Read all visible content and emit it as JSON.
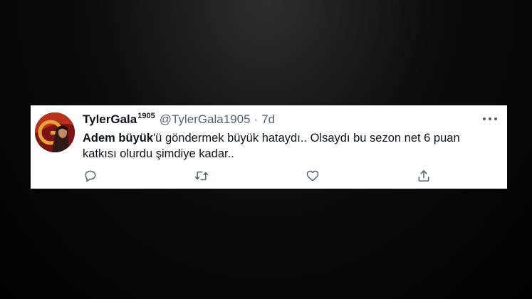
{
  "tweet": {
    "display_name": "TylerGala",
    "display_name_sup": "1905",
    "handle": "@TylerGala1905",
    "separator": "·",
    "time": "7d",
    "text": {
      "mention": "Adem büyük",
      "rest": "'ü göndermek büyük hataydı.. Olsaydı bu sezon net 6 puan katkısı olurdu şimdiye kadar.."
    }
  },
  "icons": {
    "more": "more-horizontal-icon",
    "reply": "reply-icon",
    "retweet": "retweet-icon",
    "like": "heart-icon",
    "share": "share-icon"
  },
  "colors": {
    "text_primary": "#0f1419",
    "text_secondary": "#536471",
    "avatar_red": "#8a1b1b",
    "avatar_gold": "#e8a33a"
  }
}
